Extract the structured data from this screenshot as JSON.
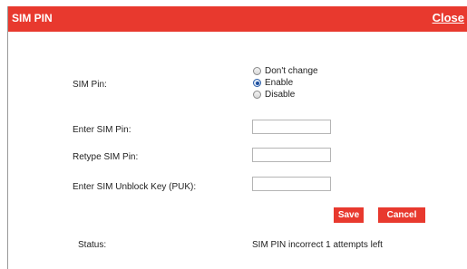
{
  "dialog": {
    "title": "SIM PIN",
    "close_label": "Close",
    "accent_color": "#e8392e"
  },
  "form": {
    "sim_pin_label": "SIM Pin:",
    "sim_pin_options": [
      {
        "label": "Don't change",
        "checked": false
      },
      {
        "label": "Enable",
        "checked": true
      },
      {
        "label": "Disable",
        "checked": false
      }
    ],
    "enter_pin_label": "Enter SIM Pin:",
    "enter_pin_value": "",
    "retype_pin_label": "Retype SIM Pin:",
    "retype_pin_value": "",
    "puk_label": "Enter SIM Unblock Key (PUK):",
    "puk_value": ""
  },
  "buttons": {
    "save_label": "Save",
    "cancel_label": "Cancel"
  },
  "status": {
    "label": "Status:",
    "value": "SIM PIN incorrect 1 attempts left"
  }
}
